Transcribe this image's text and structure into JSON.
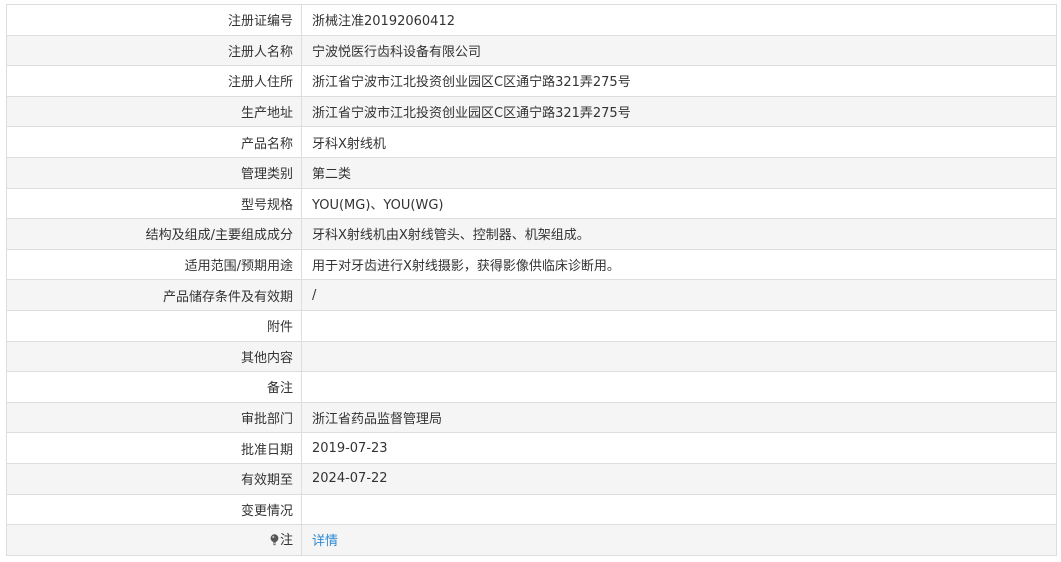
{
  "rows": [
    {
      "label": "注册证编号",
      "value": "浙械注准20192060412"
    },
    {
      "label": "注册人名称",
      "value": "宁波悦医行齿科设备有限公司"
    },
    {
      "label": "注册人住所",
      "value": "浙江省宁波市江北投资创业园区C区通宁路321弄275号"
    },
    {
      "label": "生产地址",
      "value": "浙江省宁波市江北投资创业园区C区通宁路321弄275号"
    },
    {
      "label": "产品名称",
      "value": "牙科X射线机"
    },
    {
      "label": "管理类别",
      "value": "第二类"
    },
    {
      "label": "型号规格",
      "value": "YOU(MG)、YOU(WG)"
    },
    {
      "label": "结构及组成/主要组成成分",
      "value": "牙科X射线机由X射线管头、控制器、机架组成。"
    },
    {
      "label": "适用范围/预期用途",
      "value": "用于对牙齿进行X射线摄影，获得影像供临床诊断用。"
    },
    {
      "label": "产品储存条件及有效期",
      "value": "/"
    },
    {
      "label": "附件",
      "value": ""
    },
    {
      "label": "其他内容",
      "value": ""
    },
    {
      "label": "备注",
      "value": ""
    },
    {
      "label": "审批部门",
      "value": "浙江省药品监督管理局"
    },
    {
      "label": "批准日期",
      "value": "2019-07-23"
    },
    {
      "label": "有效期至",
      "value": "2024-07-22"
    },
    {
      "label": "变更情况",
      "value": ""
    }
  ],
  "note": {
    "icon": "lightbulb-icon",
    "label": "注",
    "link_text": "详情",
    "link_color": "#2a8ad4"
  }
}
